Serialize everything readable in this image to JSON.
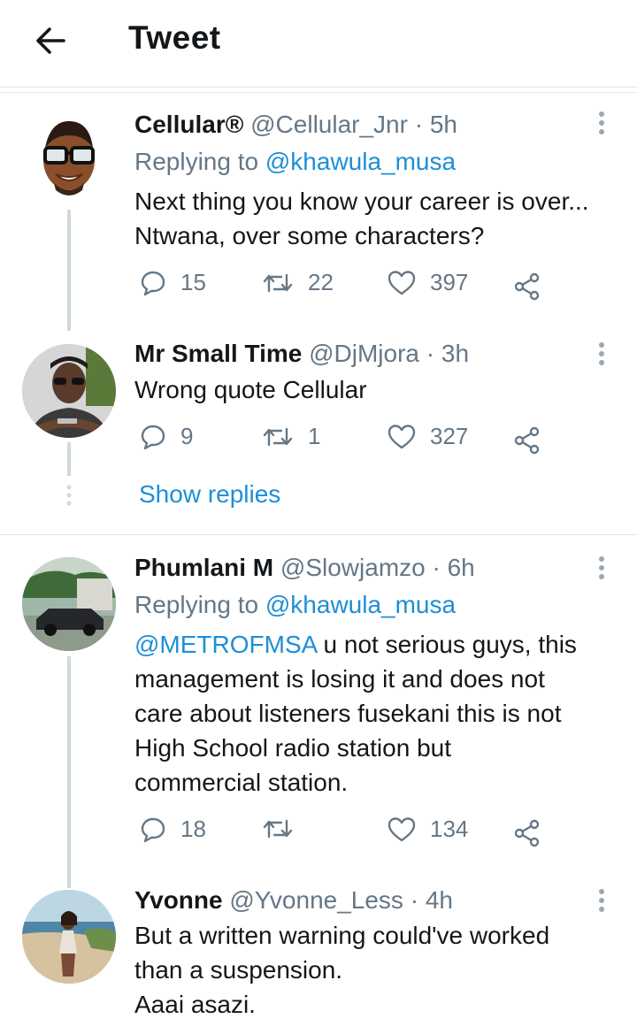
{
  "header": {
    "title": "Tweet",
    "back_icon": "arrow-left-icon"
  },
  "tweets": [
    {
      "name": "Cellular®",
      "handle": "@Cellular_Jnr",
      "time": "5h",
      "replying_prefix": "Replying to",
      "replying_to": "@khawula_musa",
      "text_lines": [
        "Next thing you know your career is over...",
        "Ntwana, over some characters?"
      ],
      "replies": "15",
      "retweets": "22",
      "likes": "397"
    },
    {
      "name": "Mr Small Time",
      "handle": "@DjMjora",
      "time": "3h",
      "text_lines": [
        "Wrong quote Cellular"
      ],
      "replies": "9",
      "retweets": "1",
      "likes": "327"
    },
    {
      "name": "Phumlani M",
      "handle": "@Slowjamzo",
      "time": "6h",
      "replying_prefix": "Replying to",
      "replying_to": "@khawula_musa",
      "mention": "@METROFMSA",
      "text_lines": [
        " u not serious guys, this",
        "management is losing it and does not",
        "care about listeners fusekani this is not",
        "High School radio station but",
        "commercial station."
      ],
      "replies": "18",
      "retweets": "",
      "likes": "134"
    },
    {
      "name": "Yvonne",
      "handle": "@Yvonne_Less",
      "time": "4h",
      "text_lines": [
        "But a written warning could've worked",
        "than a suspension.",
        "Aaai asazi."
      ]
    }
  ],
  "show_replies": "Show replies",
  "separator": " · ",
  "colors": {
    "link": "#1d8fd6",
    "secondary": "#657786",
    "divider": "#e1e6ea",
    "thread": "#cfd9de"
  }
}
